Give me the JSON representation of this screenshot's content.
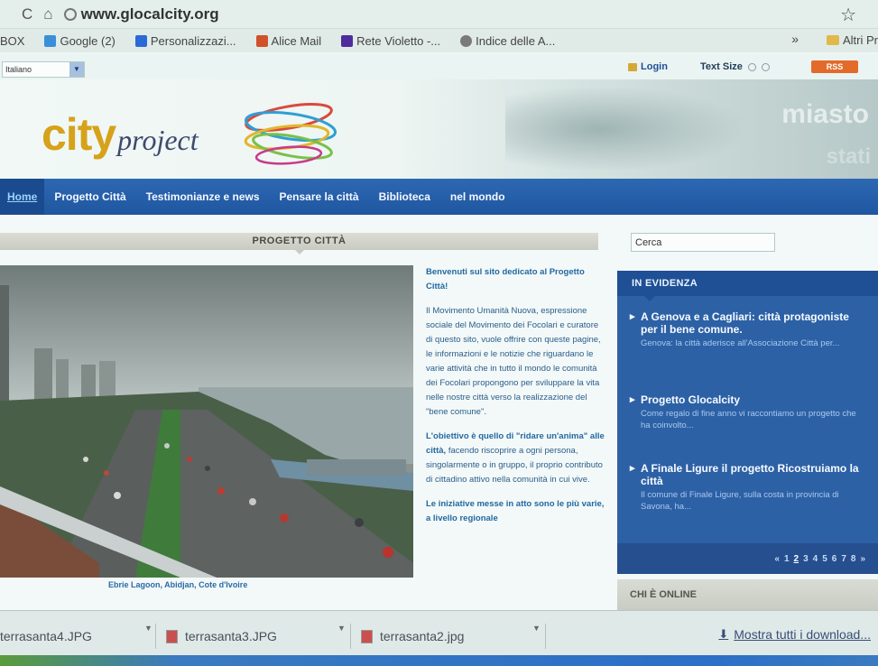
{
  "browser": {
    "reload_icon": "C",
    "home_icon": "⌂",
    "url": "www.glocalcity.org",
    "star_icon": "☆"
  },
  "bookmarks": {
    "items": [
      {
        "label": "BOX",
        "color": "#1f64c7"
      },
      {
        "label": "Google (2)",
        "color": "#3a8fd8"
      },
      {
        "label": "Personalizzazi...",
        "color": "#2b6ad6"
      },
      {
        "label": "Alice Mail",
        "color": "#d1512a"
      },
      {
        "label": "Rete Violetto -...",
        "color": "#4e2c9c"
      },
      {
        "label": "Indice delle A...",
        "color": "#7a7a7a"
      }
    ],
    "more": "»",
    "other": "Altri Pr"
  },
  "utility": {
    "language": "Italiano",
    "login": "Login",
    "text_size": "Text Size",
    "rss": "RSS"
  },
  "header": {
    "logo_city": "city",
    "logo_project": "project",
    "banner_word": "miasto",
    "banner_word2": "stati"
  },
  "nav": {
    "items": [
      {
        "label": "Home",
        "active": true
      },
      {
        "label": "Progetto Città"
      },
      {
        "label": "Testimonianze e news"
      },
      {
        "label": "Pensare la città"
      },
      {
        "label": "Biblioteca"
      },
      {
        "label": "nel mondo"
      }
    ]
  },
  "main": {
    "section_title": "PROGETTO CITTÀ",
    "photo_caption": "Ebrie Lagoon, Abidjan, Cote d'Ivoire",
    "article": {
      "lead": "Benvenuti sul sito dedicato al Progetto Città!",
      "p1": "Il Movimento Umanità Nuova, espressione sociale del Movimento dei Focolari e curatore di questo sito, vuole offrire con queste pagine, le informazioni e le notizie che riguardano le varie attività che in tutto il mondo le comunità dei Focolari propongono per sviluppare la vita nelle nostre città verso la realizzazione del \"bene comune\".",
      "p2_em": "L'obiettivo è quello di \"ridare un'anima\" alle città,",
      "p2": " facendo riscoprire a ogni persona, singolarmente o in gruppo, il proprio contributo di cittadino attivo nella comunità in cui vive.",
      "p3_em": "Le iniziative messe in atto sono le più varie, a livello regionale"
    }
  },
  "sidebar": {
    "search_value": "Cerca",
    "highlight_title": "IN EVIDENZA",
    "items": [
      {
        "title": "A Genova e a Cagliari: città protagoniste per il bene comune.",
        "desc": "Genova: la città aderisce all'Associazione Città per..."
      },
      {
        "title": "Progetto Glocalcity",
        "desc": "Come regalo di fine anno vi raccontiamo un progetto che ha coinvolto..."
      },
      {
        "title": "A Finale Ligure il progetto Ricostruiamo la città",
        "desc": "Il comune di Finale Ligure, sulla costa in provincia di Savona, ha..."
      }
    ],
    "pager": {
      "prev": "«",
      "pages": [
        "1",
        "2",
        "3",
        "4",
        "5",
        "6",
        "7",
        "8"
      ],
      "current": "2",
      "next": "»"
    },
    "online_title": "CHI È ONLINE"
  },
  "downloads": {
    "items": [
      "terrasanta4.JPG",
      "terrasanta3.JPG",
      "terrasanta2.jpg"
    ],
    "show_all": "Mostra tutti i download..."
  }
}
